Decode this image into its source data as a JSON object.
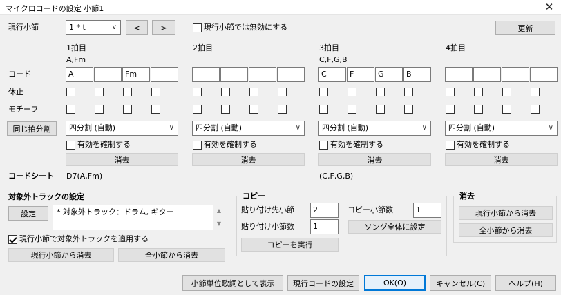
{
  "window": {
    "title": "マイクロコードの設定  小節1",
    "close_glyph": "✕"
  },
  "header": {
    "current_measure_label": "現行小節",
    "measure_value": "1 * t",
    "prev_label": "<",
    "next_label": ">",
    "disable_label": "現行小節では無効にする",
    "update_label": "更新"
  },
  "rows": {
    "chord": "コード",
    "rest": "休止",
    "motif": "モチーフ",
    "same_beat": "同じ拍分割",
    "chord_sheet": "コードシート"
  },
  "beats": [
    {
      "label": "1拍目",
      "summary": "A,Fm",
      "chords": [
        "A",
        "",
        "Fm",
        ""
      ],
      "division": "四分割 (自動)",
      "lock_label": "有効を確制する",
      "clear_label": "消去",
      "sheet": "D7(A,Fm)"
    },
    {
      "label": "2拍目",
      "summary": "",
      "chords": [
        "",
        "",
        "",
        ""
      ],
      "division": "四分割 (自動)",
      "lock_label": "有効を確制する",
      "clear_label": "消去",
      "sheet": ""
    },
    {
      "label": "3拍目",
      "summary": "C,F,G,B",
      "chords": [
        "C",
        "F",
        "G",
        "B"
      ],
      "division": "四分割 (自動)",
      "lock_label": "有効を確制する",
      "clear_label": "消去",
      "sheet": "(C,F,G,B)"
    },
    {
      "label": "4拍目",
      "summary": "",
      "chords": [
        "",
        "",
        "",
        ""
      ],
      "division": "四分割 (自動)",
      "lock_label": "有効を確制する",
      "clear_label": "消去",
      "sheet": ""
    }
  ],
  "excluded": {
    "title": "対象外トラックの設定",
    "settings_label": "設定",
    "text": "* 対象外トラック：ドラム, ギター",
    "apply_label": "現行小節で対象外トラックを適用する",
    "apply_checked": true,
    "clear_current_label": "現行小節から消去",
    "clear_all_label": "全小節から消去"
  },
  "copy": {
    "title": "コピー",
    "paste_to_label": "貼り付け先小節",
    "paste_to_value": "2",
    "paste_count_label": "貼り付け小節数",
    "paste_count_value": "1",
    "copy_count_label": "コピー小節数",
    "copy_count_value": "1",
    "song_label": "ソング全体に設定",
    "run_label": "コピーを実行"
  },
  "erase": {
    "title": "消去",
    "current_label": "現行小節から消去",
    "all_label": "全小節から消去"
  },
  "footer": {
    "lyrics_label": "小節単位歌詞として表示",
    "current_chord_label": "現行コードの設定",
    "ok_label": "OK(O)",
    "cancel_label": "キャンセル(C)",
    "help_label": "ヘルプ(H)"
  }
}
